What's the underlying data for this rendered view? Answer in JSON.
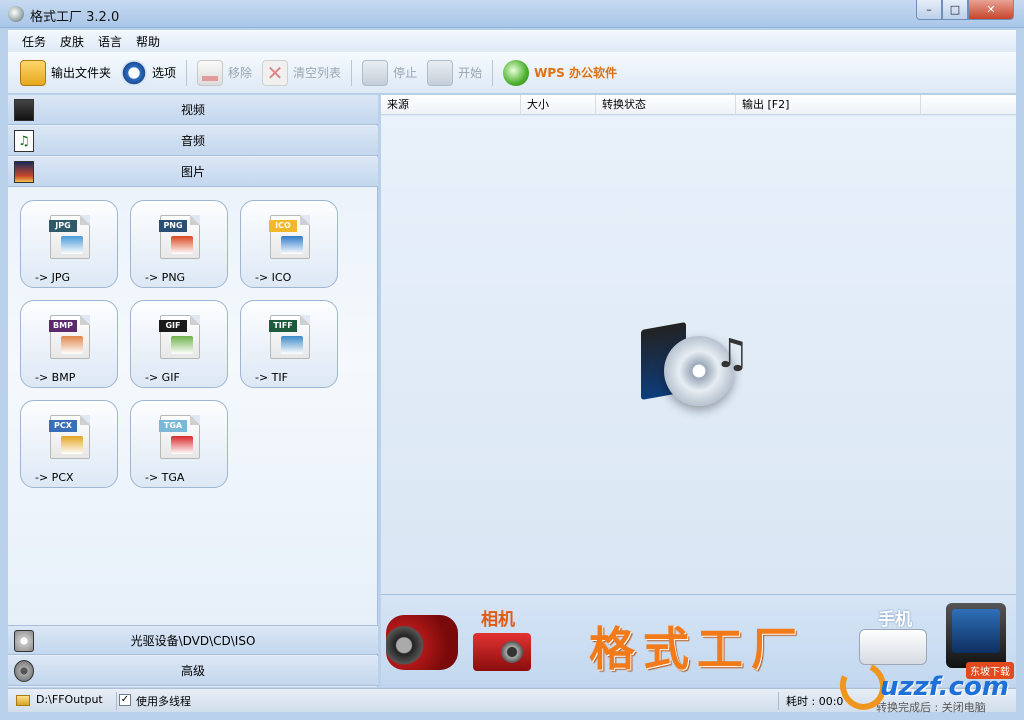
{
  "window": {
    "title": "格式工厂 3.2.0",
    "minimize": "–",
    "maximize": "□",
    "close": "✕"
  },
  "menu": [
    "任务",
    "皮肤",
    "语言",
    "帮助"
  ],
  "toolbar": {
    "output_folder": "输出文件夹",
    "options": "选项",
    "remove": "移除",
    "clear_list": "清空列表",
    "stop": "停止",
    "start": "开始",
    "wps": "WPS 办公软件"
  },
  "categories": {
    "video": "视频",
    "audio": "音频",
    "image": "图片",
    "disc": "光驱设备\\DVD\\CD\\ISO",
    "advanced": "高级"
  },
  "formats": [
    {
      "tag": "JPG",
      "label": "-> JPG",
      "tag_color": "#2e5a6a",
      "pic_color": "#4a9ad8"
    },
    {
      "tag": "PNG",
      "label": "-> PNG",
      "tag_color": "#2a4f74",
      "pic_color": "#d9461f"
    },
    {
      "tag": "ICO",
      "label": "-> ICO",
      "tag_color": "#f0b82a",
      "pic_color": "#2f7bc8"
    },
    {
      "tag": "BMP",
      "label": "-> BMP",
      "tag_color": "#5a2a6a",
      "pic_color": "#e0864a"
    },
    {
      "tag": "GIF",
      "label": "-> GIF",
      "tag_color": "#1a1a1a",
      "pic_color": "#6db04a"
    },
    {
      "tag": "TIFF",
      "label": "-> TIF",
      "tag_color": "#1e5a3c",
      "pic_color": "#3c8ac8"
    },
    {
      "tag": "PCX",
      "label": "-> PCX",
      "tag_color": "#3a6fb8",
      "pic_color": "#e3a421"
    },
    {
      "tag": "TGA",
      "label": "-> TGA",
      "tag_color": "#7ab8d8",
      "pic_color": "#d8282c"
    }
  ],
  "list_columns": [
    "来源",
    "大小",
    "转换状态",
    "输出 [F2]"
  ],
  "banner": {
    "camera_label": "相机",
    "title": "格式工厂",
    "phone_label": "手机"
  },
  "status": {
    "output_path": "D:\\FFOutput",
    "multithread_check": "✓",
    "multithread": "使用多线程",
    "elapsed": "耗时 : 00:0",
    "after_convert": "转换完成后 : 关闭电脑"
  },
  "watermark": {
    "text": "uzzf.com",
    "badge": "东坡下载"
  }
}
